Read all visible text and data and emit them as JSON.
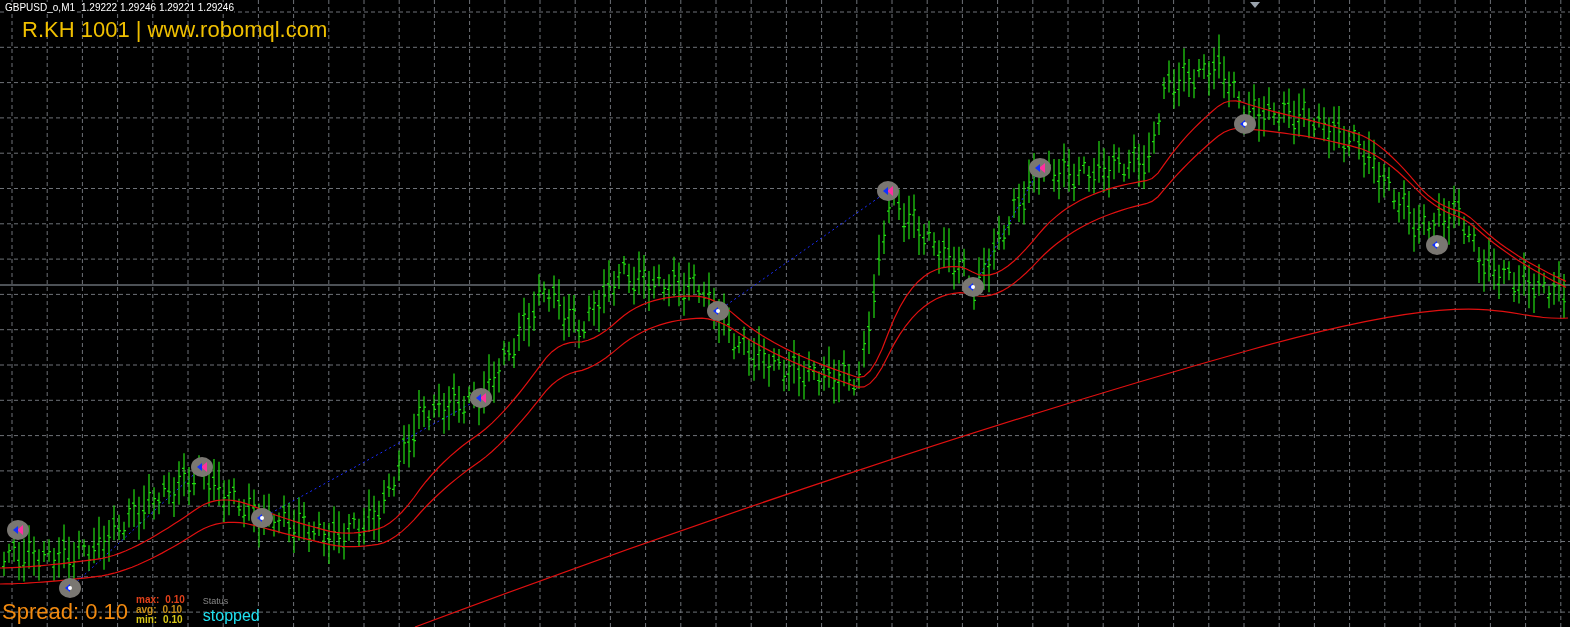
{
  "chart_header": {
    "symbol": "GBPUSD_o,M1",
    "quotes": "1.29222 1.29246 1.29221 1.29246"
  },
  "title": "R.KH 1001 | www.robomql.com",
  "spread": {
    "label": "Spread: 0.10",
    "stats": [
      {
        "label": "max:",
        "value": "0.10",
        "color": "#e0401a"
      },
      {
        "label": "avg:",
        "value": "0.10",
        "color": "#c8901a"
      },
      {
        "label": "min:",
        "value": "0.10",
        "color": "#d8c818"
      }
    ]
  },
  "status": {
    "label": "Status",
    "value": "stopped"
  }
}
